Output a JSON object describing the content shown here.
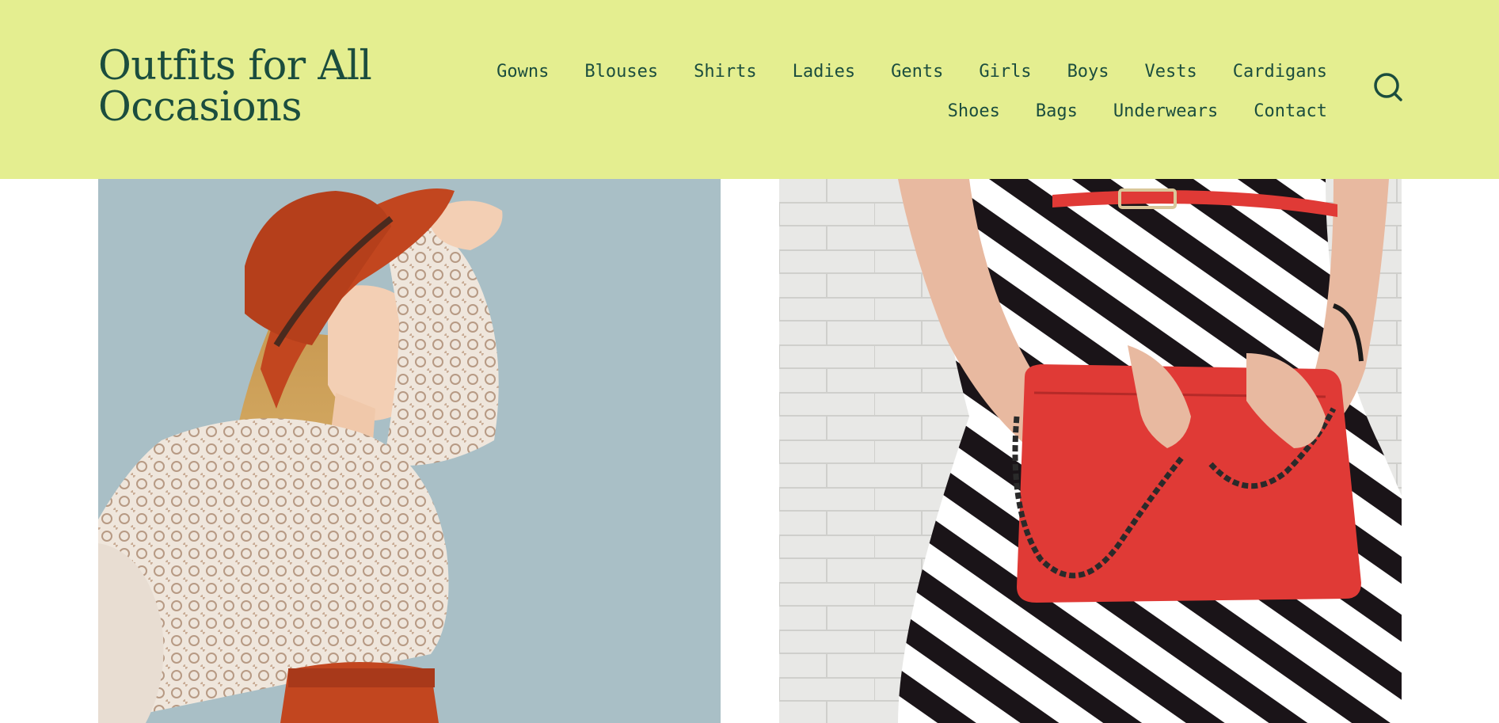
{
  "site": {
    "title": "Outfits for All Occasions"
  },
  "nav": {
    "row1": [
      "Gowns",
      "Blouses",
      "Shirts",
      "Ladies",
      "Gents",
      "Girls",
      "Boys",
      "Vests",
      "Cardigans"
    ],
    "row2": [
      "Shoes",
      "Bags",
      "Underwears",
      "Contact"
    ]
  },
  "search": {
    "icon": "search-icon"
  },
  "colors": {
    "header_bg": "#e4ee90",
    "brand_text": "#1b4d3e",
    "photo_left_bg": "#a9bfc6",
    "hat": "#c2461f",
    "bag": "#e03a36"
  },
  "images": [
    {
      "name": "woman-red-hat-lace-blouse-photo"
    },
    {
      "name": "red-clutch-striped-dress-photo"
    }
  ]
}
